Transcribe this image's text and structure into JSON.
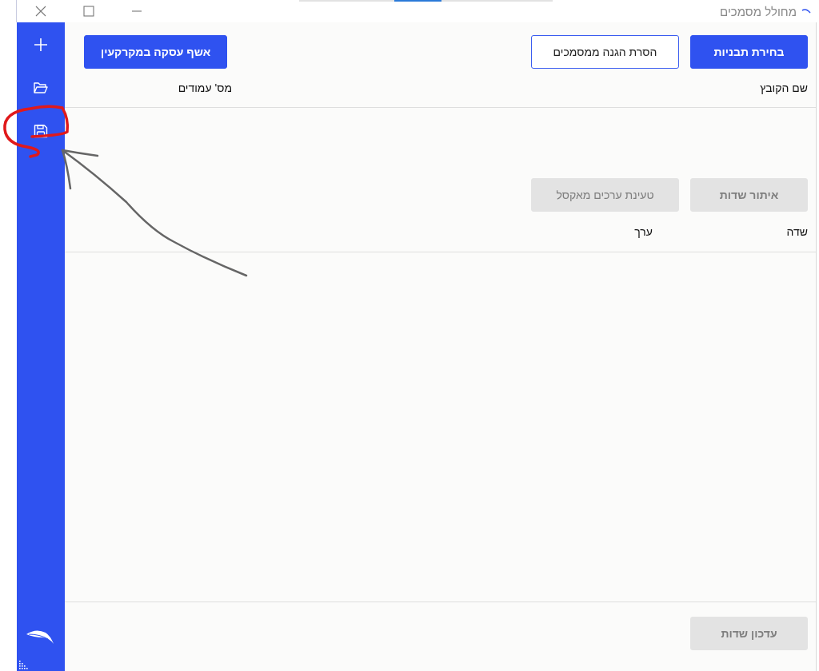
{
  "window": {
    "title": "מחולל מסמכים"
  },
  "sidebar": {
    "items": [
      {
        "kind": "new"
      },
      {
        "kind": "open"
      },
      {
        "kind": "save"
      }
    ]
  },
  "toolbar": {
    "buttons": [
      {
        "label": "בחירת תבניות",
        "kind": "primary",
        "disabled": false
      },
      {
        "label": "הסרת הגנה ממסמכים",
        "kind": "outline",
        "disabled": false
      },
      {
        "label": "אשף עסקה במקרקעין",
        "kind": "primary",
        "disabled": false
      }
    ]
  },
  "files_table": {
    "columns": [
      "שם הקובץ",
      "מס' עמודים"
    ]
  },
  "field_actions": {
    "buttons": [
      {
        "label": "איתור שדות",
        "kind": "primary",
        "disabled": true
      },
      {
        "label": "טעינת ערכים מאקסל",
        "kind": "outline",
        "disabled": true
      }
    ]
  },
  "fields_table": {
    "columns": [
      "שדה",
      "ערך"
    ]
  },
  "footer": {
    "buttons": [
      {
        "label": "עדכון שדות",
        "kind": "primary",
        "disabled": true
      }
    ]
  },
  "annotations": [
    {
      "kind": "circle",
      "color": "#e0191b"
    },
    {
      "kind": "arrow",
      "color": "#666666"
    }
  ]
}
